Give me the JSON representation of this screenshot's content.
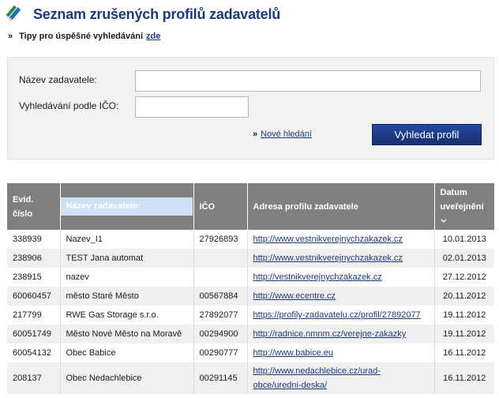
{
  "page": {
    "title": "Seznam zrušených profilů zadavatelů",
    "tips_text": "Tipy pro úspěšné vyhledávání",
    "tips_link": "zde",
    "raquo": "»"
  },
  "search": {
    "name_label": "Název zadavatele:",
    "name_value": "",
    "ico_label": "Vyhledávání podle IČO:",
    "ico_value": "",
    "new_search_link": "Nové hledání",
    "submit_label": "Vyhledat profil"
  },
  "table": {
    "headers": {
      "evid": "Evid. číslo",
      "name": "Název zadavatele:",
      "ico": "IČO",
      "url": "Adresa profilu zadavatele",
      "date": "Datum uveřejnění"
    },
    "rows": [
      {
        "evid": "338939",
        "name": "Nazev_I1",
        "ico": "27926893",
        "url": "http://www.vestnikverejnychzakazek.cz",
        "date": "10.01.2013"
      },
      {
        "evid": "238906",
        "name": "TEST Jana automat",
        "ico": "",
        "url": "http://www.vestnikverejnychzakazek.cz",
        "date": "02.01.2013"
      },
      {
        "evid": "238915",
        "name": "nazev",
        "ico": "",
        "url": "http://vestnikverejnychzakazek.cz",
        "date": "27.12.2012"
      },
      {
        "evid": "60060457",
        "name": "město Staré Město",
        "ico": "00567884",
        "url": "http://www.ecentre.cz",
        "date": "20.11.2012"
      },
      {
        "evid": "217799",
        "name": "RWE Gas Storage s.r.o.",
        "ico": "27892077",
        "url": "https://profily-zadavatelu.cz/profil/27892077",
        "date": "19.11.2012"
      },
      {
        "evid": "60051749",
        "name": "Město Nové Město na Moravě",
        "ico": "00294900",
        "url": "http://radnice.nmnm.cz/verejne-zakazky",
        "date": "19.11.2012"
      },
      {
        "evid": "60054132",
        "name": "Obec Babice",
        "ico": "00290777",
        "url": "http://www.babice.eu",
        "date": "16.11.2012"
      },
      {
        "evid": "208137",
        "name": "Obec Nedachlebice",
        "ico": "00291145",
        "url": "http://www.nedachlebice.cz/urad-obce/uredni-deska/",
        "date": "16.11.2012"
      }
    ]
  },
  "colors": {
    "accent": "#1d3a78",
    "button": "#1f3f8c",
    "header_bg": "#808080",
    "sorted_header_bg": "#cde0f4"
  }
}
